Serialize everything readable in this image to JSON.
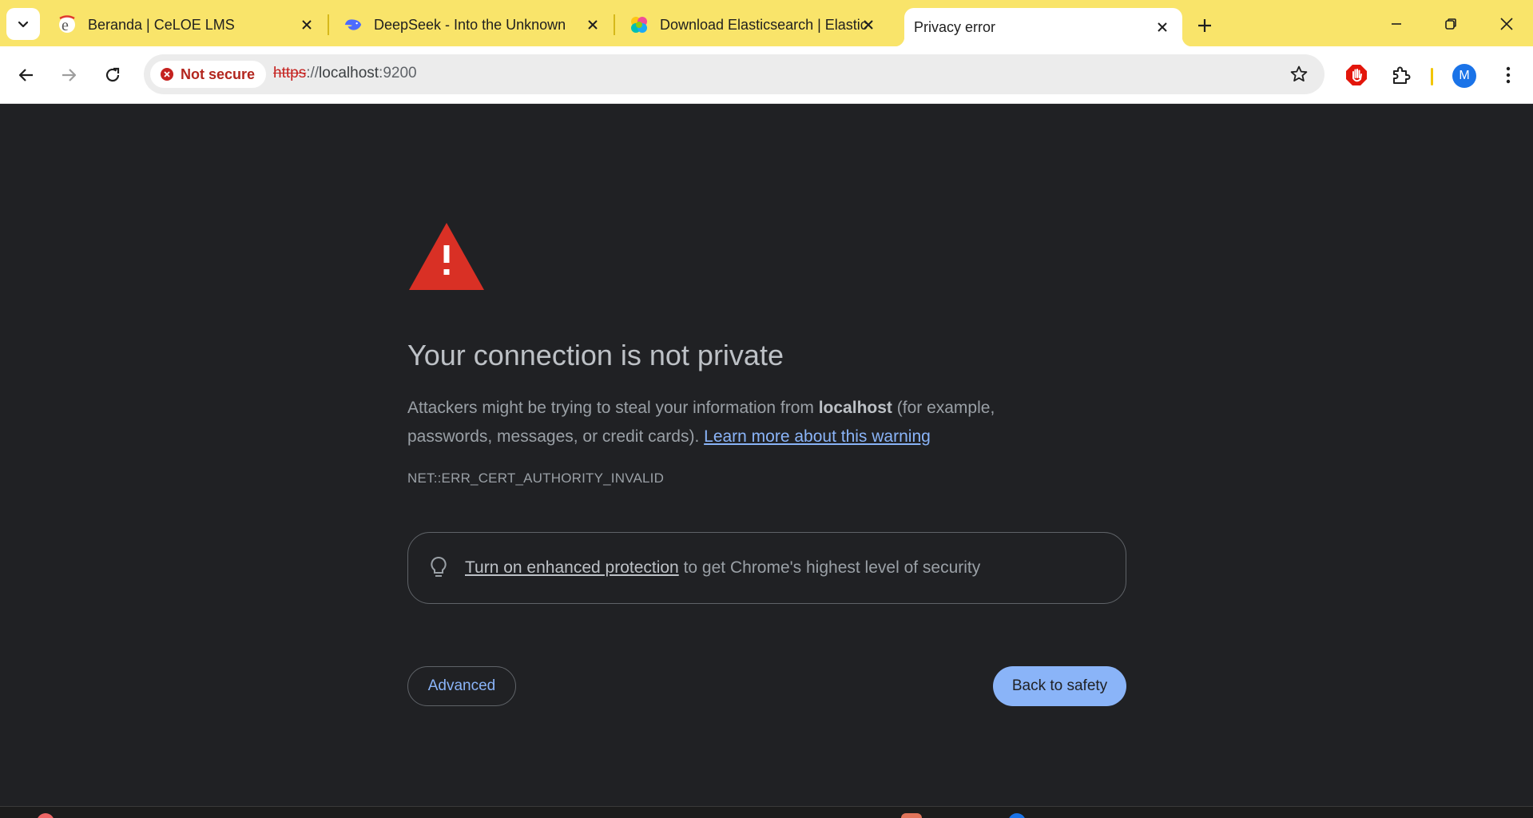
{
  "tabs": [
    {
      "title": "Beranda | CeLOE LMS",
      "favicon": "celoe-favicon",
      "active": false
    },
    {
      "title": "DeepSeek - Into the Unknown",
      "favicon": "deepseek-whale-favicon",
      "active": false
    },
    {
      "title": "Download Elasticsearch | Elastic",
      "favicon": "elastic-favicon",
      "active": false
    },
    {
      "title": "Privacy error",
      "favicon": "",
      "active": true
    }
  ],
  "toolbar": {
    "security_chip": "Not secure",
    "url_scheme": "https",
    "url_sep": "://",
    "url_host": "localhost",
    "url_port": ":9200",
    "profile_initial": "M"
  },
  "interstitial": {
    "heading": "Your connection is not private",
    "desc_prefix": "Attackers might be trying to steal your information from ",
    "desc_host": "localhost",
    "desc_suffix": " (for example, passwords, messages, or credit cards). ",
    "learn_more": "Learn more about this warning",
    "error_code": "NET::ERR_CERT_AUTHORITY_INVALID",
    "enhanced_link": "Turn on enhanced protection",
    "enhanced_rest": " to get Chrome's highest level of security",
    "advanced_label": "Advanced",
    "back_label": "Back to safety"
  },
  "colors": {
    "tabstrip": "#f9e46a",
    "page_bg": "#202124",
    "warning_red": "#d93025",
    "link_blue": "#8ab4f8"
  }
}
